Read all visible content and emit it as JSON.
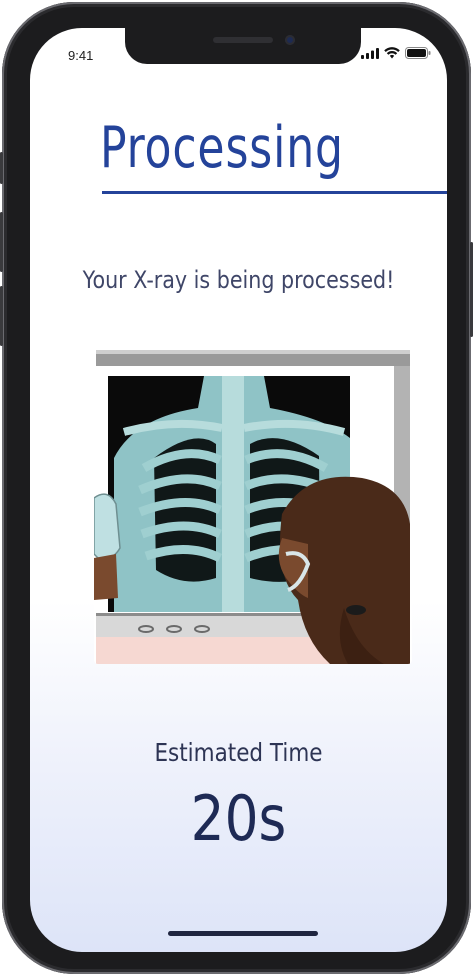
{
  "status_bar": {
    "time": "9:41",
    "icons": [
      "signal-icon",
      "wifi-icon",
      "battery-icon"
    ]
  },
  "screen": {
    "title": "Processing",
    "subtitle": "Your X-ray is being processed!",
    "illustration": "xray-doctor-illustration",
    "estimate_label": "Estimated Time",
    "estimate_value": "20s"
  },
  "colors": {
    "accent": "#24439a",
    "text": "#3f4668",
    "value": "#1e2a55"
  }
}
